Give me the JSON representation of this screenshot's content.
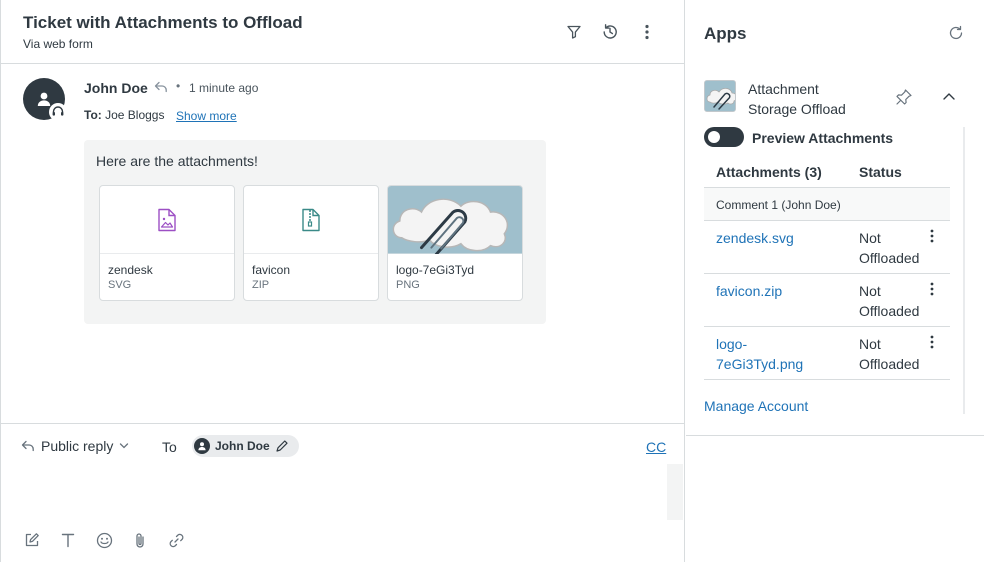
{
  "ticket": {
    "title": "Ticket with Attachments to Offload",
    "channel": "Via web form"
  },
  "comment": {
    "author": "John Doe",
    "separator": "•",
    "time": "1 minute ago",
    "to_label": "To:",
    "to_name": "Joe Bloggs",
    "show_more": "Show more",
    "message": "Here are the attachments!",
    "attachments": [
      {
        "name": "zendesk",
        "type": "SVG",
        "icon": "image-file-icon"
      },
      {
        "name": "favicon",
        "type": "ZIP",
        "icon": "zip-file-icon"
      },
      {
        "name": "logo-7eGi3Tyd",
        "type": "PNG",
        "icon": "cloud-paperclip-thumbnail"
      }
    ]
  },
  "reply": {
    "type": "Public reply",
    "to_label": "To",
    "recipient": "John Doe",
    "cc": "CC"
  },
  "apps": {
    "title": "Apps",
    "app_name": "Attachment Storage Offload",
    "preview_label": "Preview Attachments",
    "preview_enabled": false,
    "table": {
      "col_attachments": "Attachments (3)",
      "col_status": "Status",
      "group": "Comment 1 (John Doe)",
      "rows": [
        {
          "file": "zendesk.svg",
          "status": "Not Offloaded"
        },
        {
          "file": "favicon.zip",
          "status": "Not Offloaded"
        },
        {
          "file": "logo-7eGi3Tyd.png",
          "status": "Not Offloaded"
        }
      ]
    },
    "manage": "Manage Account"
  },
  "colors": {
    "link": "#1f73b7",
    "text": "#2f3941",
    "border": "#d8dcde",
    "image_icon": "#9c4fc4",
    "zip_icon": "#3a8a88"
  }
}
